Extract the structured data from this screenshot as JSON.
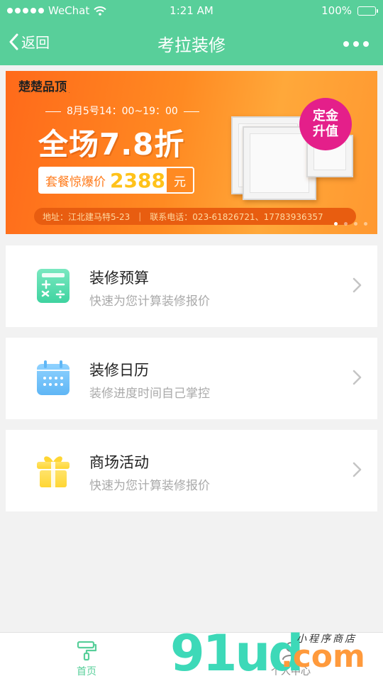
{
  "status_bar": {
    "carrier": "WeChat",
    "time": "1:21 AM",
    "battery": "100%"
  },
  "nav": {
    "back_label": "返回",
    "title": "考拉装修"
  },
  "banner": {
    "brand": "楚楚品顶",
    "date": "8月5号14：00~19：00",
    "sale": "全场7.8折",
    "package_label": "套餐惊爆价",
    "package_price": "2388",
    "package_unit": "元",
    "badge_line1": "定金",
    "badge_line2": "升值",
    "address": "地址：江北建马特5-23",
    "phone": "联系电话：023-61826721、17783936357",
    "pager_count": 4,
    "pager_active": 1
  },
  "items": [
    {
      "title": "装修预算",
      "subtitle": "快速为您计算装修报价",
      "icon": "calculator-icon"
    },
    {
      "title": "装修日历",
      "subtitle": "装修进度时间自己掌控",
      "icon": "calendar-icon"
    },
    {
      "title": "商场活动",
      "subtitle": "快速为您计算装修报价",
      "icon": "gift-icon"
    }
  ],
  "tabbar": {
    "tabs": [
      {
        "label": "首页",
        "icon": "paint-roller-icon",
        "active": true
      },
      {
        "label": "个人中心",
        "icon": "user-icon",
        "active": false
      }
    ]
  },
  "watermark": {
    "main": "91ud",
    "suffix": ".com",
    "tagline": "小程序商店"
  },
  "colors": {
    "accent": "#58cf9a",
    "banner_orange": "#ff8a22",
    "badge": "#e41f8a"
  }
}
